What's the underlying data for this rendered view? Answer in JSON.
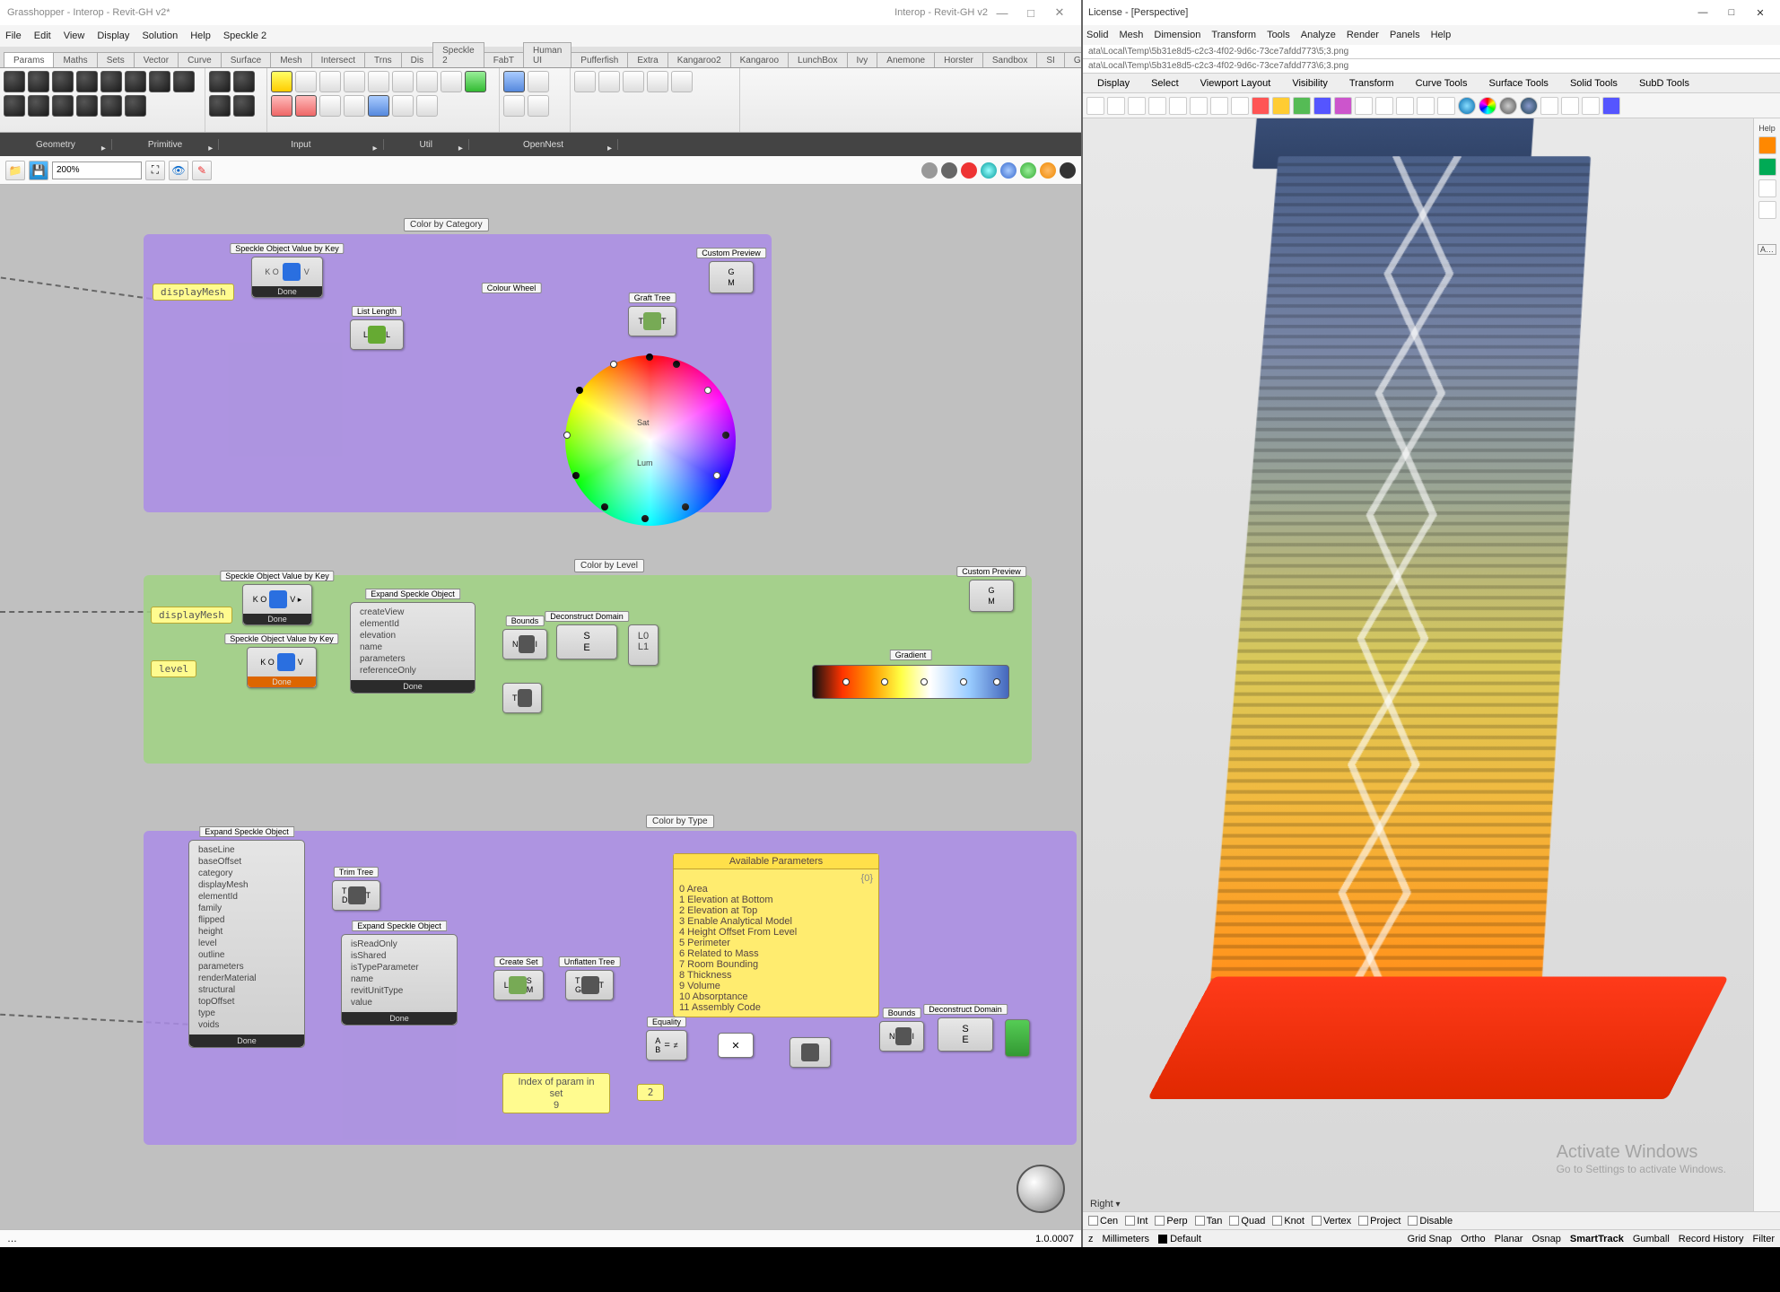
{
  "gh": {
    "title": "Grasshopper - Interop - Revit-GH v2*",
    "doc": "Interop - Revit-GH v2",
    "menu": [
      "File",
      "Edit",
      "View",
      "Display",
      "Solution",
      "Help",
      "Speckle 2"
    ],
    "tabs": [
      "Params",
      "Maths",
      "Sets",
      "Vector",
      "Curve",
      "Surface",
      "Mesh",
      "Intersect",
      "Trns",
      "Dis",
      "Speckle 2",
      "FabT",
      "Human UI",
      "Pufferfish",
      "Extra",
      "Kangaroo2",
      "Kangaroo",
      "LunchBox",
      "Ivy",
      "Anemone",
      "Horster",
      "Sandbox",
      "SI",
      "GhExcel"
    ],
    "active_tab": "Params",
    "ribbon_groups": [
      "Geometry",
      "Primitive",
      "Input",
      "Util",
      "OpenNest"
    ],
    "zoom": "200%",
    "version": "1.0.0007",
    "status": "…"
  },
  "rh": {
    "title": "License - [Perspective]",
    "menu": [
      "Solid",
      "Mesh",
      "Dimension",
      "Transform",
      "Tools",
      "Analyze",
      "Render",
      "Panels",
      "Help"
    ],
    "cmd1": "ata\\Local\\Temp\\5b31e8d5-c2c3-4f02-9d6c-73ce7afdd773\\5;3.png",
    "cmd2": "ata\\Local\\Temp\\5b31e8d5-c2c3-4f02-9d6c-73ce7afdd773\\6;3.png",
    "tabs": [
      "Display",
      "Select",
      "Viewport Layout",
      "Visibility",
      "Transform",
      "Curve Tools",
      "Surface Tools",
      "Solid Tools",
      "SubD Tools"
    ],
    "side_help": "Help",
    "side_a": "A…",
    "viewport_label": "Right",
    "activate1": "Activate Windows",
    "activate2": "Go to Settings to activate Windows.",
    "osnaps": [
      "Cen",
      "Int",
      "Perp",
      "Tan",
      "Quad",
      "Knot",
      "Vertex",
      "Project",
      "Disable"
    ],
    "axis": "z",
    "units": "Millimeters",
    "layer": "Default",
    "aids": [
      "Grid Snap",
      "Ortho",
      "Planar",
      "Osnap",
      "SmartTrack",
      "Gumball",
      "Record History",
      "Filter"
    ],
    "aid_on": "SmartTrack"
  },
  "groups": {
    "g1_title": "Color by Category",
    "g2_title": "Color by Level",
    "g3_title": "Color by Type"
  },
  "nodes": {
    "sok": "Speckle Object Value by Key",
    "done": "Done",
    "listlen": "List Length",
    "cwheel": "Colour Wheel",
    "graft": "Graft Tree",
    "cpreview": "Custom Preview",
    "eso": "Expand Speckle Object",
    "bounds": "Bounds",
    "decon": "Deconstruct Domain",
    "gradient": "Gradient",
    "trim": "Trim Tree",
    "createset": "Create Set",
    "unflatten": "Unflatten Tree",
    "equality": "Equality",
    "idx_param": "Index of param in set",
    "p_displayMesh": "displayMesh",
    "p_level": "level",
    "p_9": "9",
    "p_2": "2",
    "wheel_sat": "Sat",
    "wheel_lum": "Lum"
  },
  "eso_rows1": [
    "createView",
    "elementId",
    "elevation",
    "name",
    "parameters",
    "referenceOnly"
  ],
  "eso_rows2": [
    "baseLine",
    "baseOffset",
    "category",
    "displayMesh",
    "elementId",
    "family",
    "flipped",
    "height",
    "level",
    "outline",
    "parameters",
    "renderMaterial",
    "structural",
    "topOffset",
    "type",
    "voids"
  ],
  "eso_rows3": [
    "isReadOnly",
    "isShared",
    "isTypeParameter",
    "name",
    "revitUnitType",
    "value"
  ],
  "panel": {
    "title": "Available Parameters",
    "idx": "{0}",
    "rows": [
      "0 Area",
      "1 Elevation at Bottom",
      "2 Elevation at Top",
      "3 Enable Analytical Model",
      "4 Height Offset From Level",
      "5 Perimeter",
      "6 Related to Mass",
      "7 Room Bounding",
      "8 Thickness",
      "9 Volume",
      "10 Absorptance",
      "11 Assembly Code"
    ]
  }
}
